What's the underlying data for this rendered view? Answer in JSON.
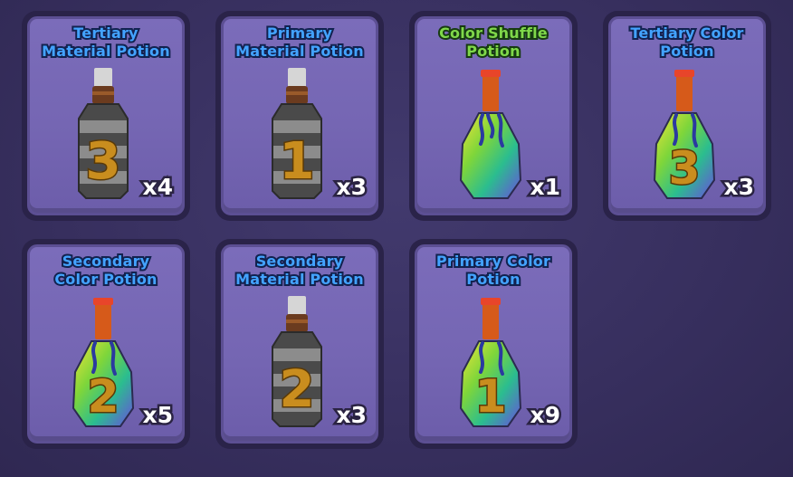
{
  "inventory": {
    "items": [
      {
        "title": "Tertiary Material Potion",
        "count": "x4",
        "number": "3",
        "kind": "material",
        "title_color": "#43a3ff"
      },
      {
        "title": "Primary Material Potion",
        "count": "x3",
        "number": "1",
        "kind": "material",
        "title_color": "#43a3ff"
      },
      {
        "title": "Color Shuffle Potion",
        "count": "x1",
        "number": "",
        "kind": "rainbow",
        "title_color": "#7fd84a"
      },
      {
        "title": "Tertiary Color Potion",
        "count": "x3",
        "number": "3",
        "kind": "rainbow",
        "title_color": "#43a3ff"
      },
      {
        "title": "Secondary Color Potion",
        "count": "x5",
        "number": "2",
        "kind": "rainbow",
        "title_color": "#43a3ff"
      },
      {
        "title": "Secondary Material Potion",
        "count": "x3",
        "number": "2",
        "kind": "material",
        "title_color": "#43a3ff"
      },
      {
        "title": "Primary Color Potion",
        "count": "x9",
        "number": "1",
        "kind": "rainbow",
        "title_color": "#43a3ff"
      }
    ]
  },
  "icons": {
    "material": "grey-striped-bottle-icon",
    "rainbow": "rainbow-bottle-icon"
  },
  "colors": {
    "background": "#3a3362",
    "card": "#7566b3",
    "card_border": "#5c4f93",
    "number_gold": "#c98d1e"
  }
}
